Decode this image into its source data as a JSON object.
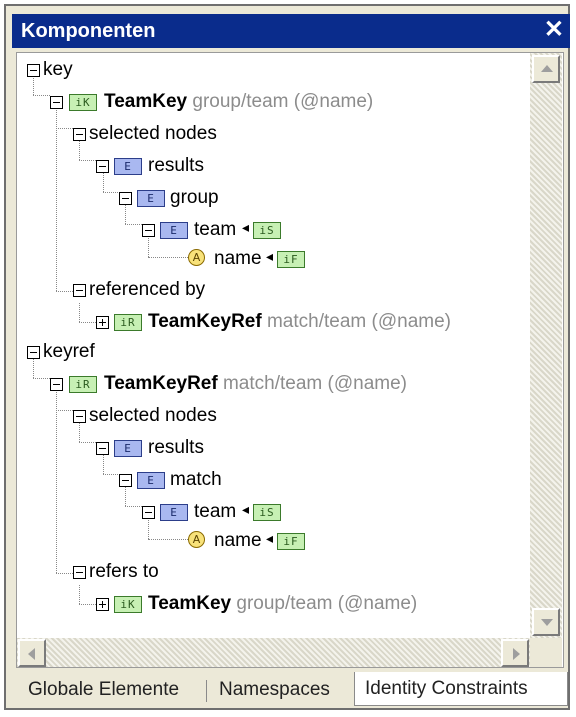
{
  "window": {
    "title": "Komponenten",
    "close_symbol": "✕"
  },
  "tree": {
    "key_label": "key",
    "teamkey_name": "TeamKey",
    "teamkey_path": "group/team (@name)",
    "selected_nodes_label": "selected nodes",
    "results_label": "results",
    "group_label": "group",
    "team_label": "team",
    "name_label": "name",
    "referenced_by_label": "referenced by",
    "teamkeyref_name": "TeamKeyRef",
    "teamkeyref_path": "match/team (@name)",
    "keyref_label": "keyref",
    "selected_nodes_label_2": "selected nodes",
    "results_label_2": "results",
    "match_label": "match",
    "team_label_2": "team",
    "name_label_2": "name",
    "refers_to_label": "refers to",
    "teamkey2_name": "TeamKey",
    "teamkey2_path": "group/team (@name)"
  },
  "badges": {
    "element": "E",
    "key": "iK",
    "keyref": "iR",
    "selector": "iS",
    "field": "iF",
    "attribute": "A"
  },
  "tabs": {
    "global_elements": "Globale Elemente",
    "namespaces": "Namespaces",
    "identity_constraints": "Identity Constraints",
    "active": "Identity Constraints"
  },
  "colors": {
    "title_bar": "#0a2c8c",
    "element_badge": "#a9b8f0",
    "constraint_badge": "#c7f0b4",
    "attribute_badge": "#f8e27a",
    "path_text": "#8c8c8c"
  }
}
